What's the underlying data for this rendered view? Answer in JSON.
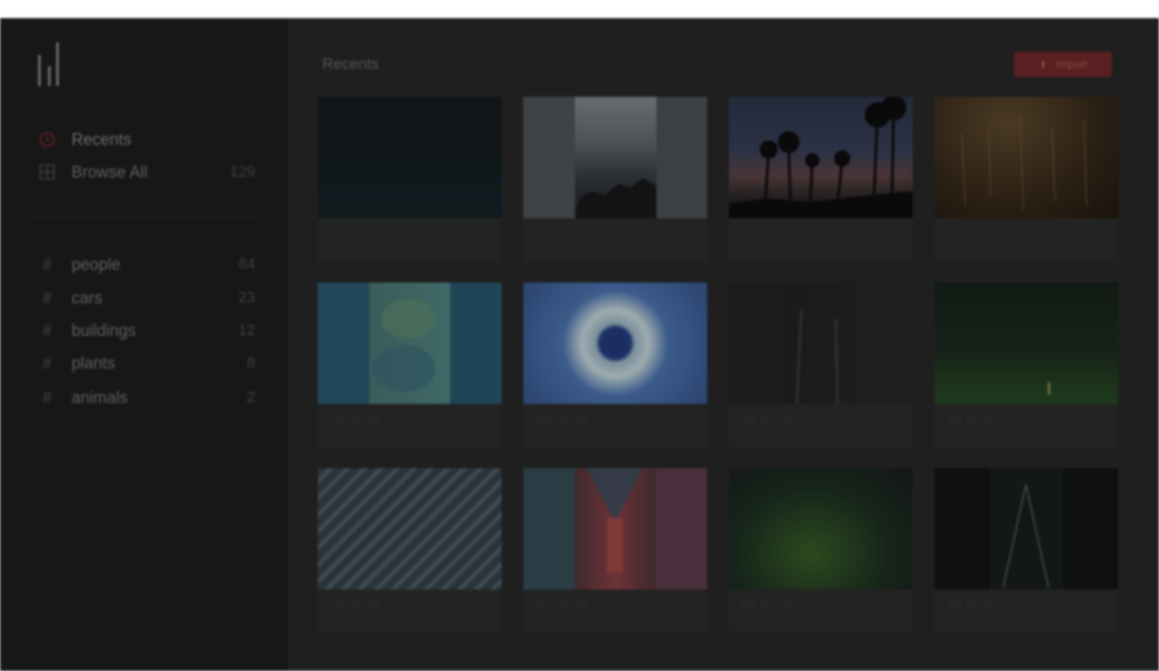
{
  "sidebar": {
    "nav": [
      {
        "label": "Recents",
        "icon": "clock-icon",
        "count": ""
      },
      {
        "label": "Browse All",
        "icon": "grid-icon",
        "count": "129"
      }
    ],
    "tags": [
      {
        "label": "people",
        "count": "84"
      },
      {
        "label": "cars",
        "count": "23"
      },
      {
        "label": "buildings",
        "count": "12"
      },
      {
        "label": "plants",
        "count": "8"
      },
      {
        "label": "animals",
        "count": "2"
      }
    ]
  },
  "main": {
    "title": "Recents",
    "import_label": "Import"
  },
  "colors": {
    "accent": "#5a1f20",
    "active_icon": "#5b2222"
  }
}
